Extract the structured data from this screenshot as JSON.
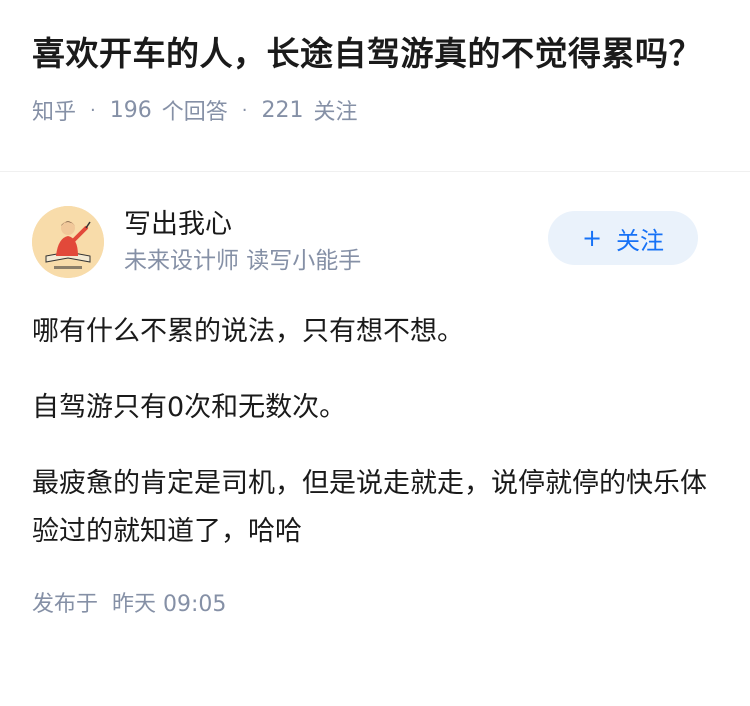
{
  "question": {
    "title": "喜欢开车的人，长途自驾游真的不觉得累吗？",
    "source": "知乎",
    "answer_count": "196",
    "answer_label": "个回答",
    "follow_count": "221",
    "follow_label": "关注",
    "separator": "·"
  },
  "answer": {
    "author": {
      "name": "写出我心",
      "bio": "未来设计师 读写小能手",
      "avatar_icon": "author-avatar-illustration"
    },
    "follow_button": {
      "icon": "+",
      "label": "关注"
    },
    "paragraphs": [
      "哪有什么不累的说法，只有想不想。",
      "自驾游只有0次和无数次。",
      "最疲惫的肯定是司机，但是说走就走，说停就停的快乐体验过的就知道了，哈哈"
    ],
    "publish_label": "发布于",
    "publish_time": "昨天 09:05"
  },
  "colors": {
    "accent": "#1772f6",
    "meta_gray": "#8590a6",
    "text": "#1a1a1a",
    "follow_bg": "#eaf2fb"
  }
}
